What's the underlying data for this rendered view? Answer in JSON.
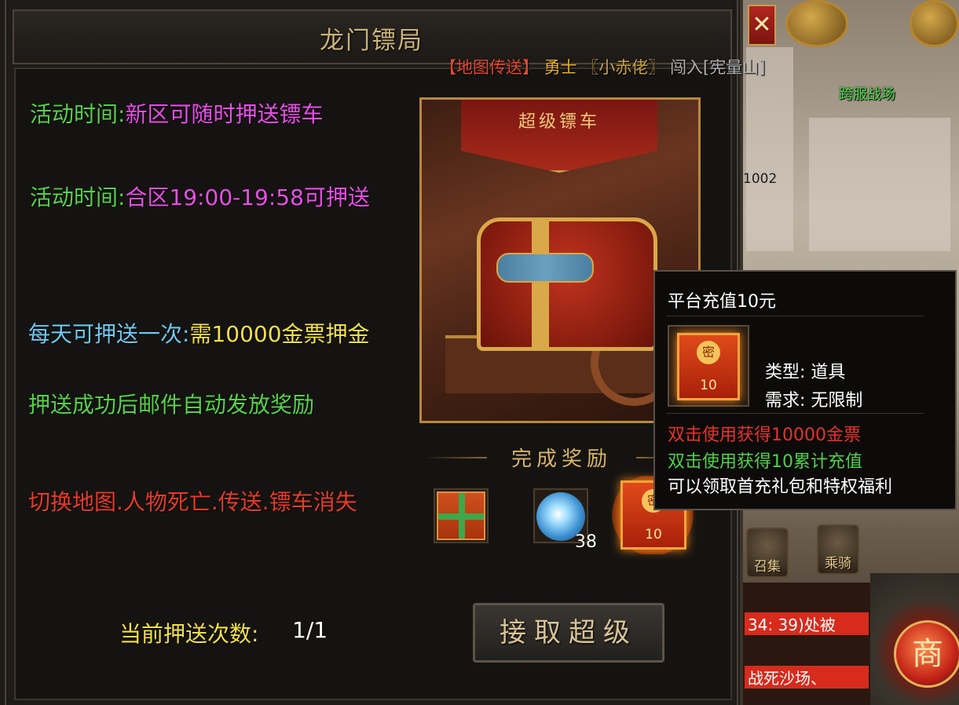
{
  "panel": {
    "title": "龙门镖局"
  },
  "broadcast": {
    "part1": "【地图传送】",
    "part2": "勇士",
    "part3": "〖小赤佬〗",
    "part4": "闯入[宪量山]"
  },
  "info": {
    "line1_label": "活动时间:",
    "line1_value": "新区可随时押送镖车",
    "line2_label": "活动时间:",
    "line2_value": "合区19:00-19:58可押送",
    "line3_label": "每天可押送一次:",
    "line3_value": "需10000金票押金",
    "line4": "押送成功后邮件自动发放奖励",
    "line5": "切换地图.人物死亡.传送.镖车消失"
  },
  "cart_image": {
    "banner_text": "超级镖车"
  },
  "rewards": {
    "title": "完成奖励",
    "items": [
      {
        "icon": "gift-box-icon"
      },
      {
        "icon": "crystal-orb-icon",
        "count": "38"
      },
      {
        "icon": "red-card-icon",
        "amount": "10"
      }
    ]
  },
  "escort": {
    "count_label": "当前押送次数:",
    "count_value": "1/1",
    "accept_label": "接取超级"
  },
  "tooltip": {
    "title": "平台充值10元",
    "icon_amount": "10",
    "type": "类型: 道具",
    "need": "需求: 无限制",
    "line1": "双击使用获得10000金票",
    "line2": "双击使用获得10累计充值",
    "line3": "可以领取首充礼包和特权福利"
  },
  "world": {
    "close_label": "✕",
    "label1": "跨服战场",
    "map_num": "1002",
    "skill1": "召集",
    "skill2": "乘骑",
    "chat1": "34: 39)处被",
    "chat2": "战死沙场、",
    "shop_label": "商"
  },
  "colors": {
    "green": "#56d14a",
    "magenta": "#e84ee8",
    "cyan": "#6fc8f0",
    "yellow": "#f2e04a",
    "red": "#e83a2a",
    "gold": "#c9b27a"
  }
}
